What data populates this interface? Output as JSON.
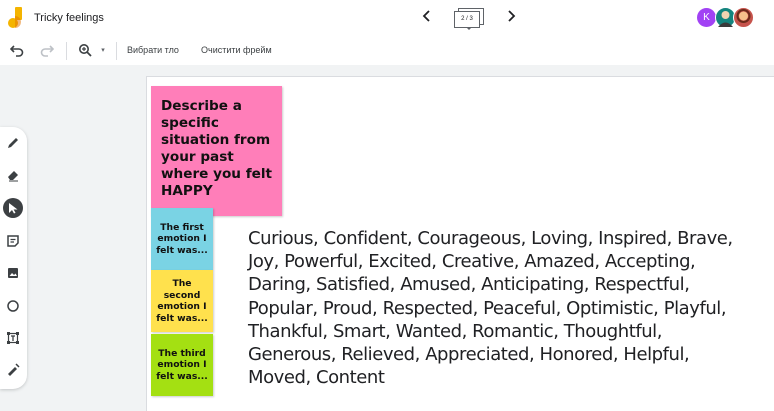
{
  "header": {
    "title": "Tricky feelings",
    "frame_indicator": "2 / 3"
  },
  "collaborators": [
    {
      "initial": "K",
      "color": "#a142f4"
    },
    {
      "initial": "",
      "color": "#14847e"
    },
    {
      "initial": "",
      "color": "#c6534c"
    }
  ],
  "toolbar": {
    "set_background_label": "Вибрати тло",
    "clear_frame_label": "Очистити фрейм"
  },
  "tools": [
    "pen-icon",
    "eraser-icon",
    "select-icon",
    "sticky-note-icon",
    "image-icon",
    "circle-icon",
    "text-box-icon",
    "laser-icon"
  ],
  "canvas": {
    "main_note": "Describe a specific situation from your past where you felt HAPPY",
    "notes": [
      {
        "text": "The first emotion I felt was...",
        "color": "#7ad3e4"
      },
      {
        "text": "The second emotion I felt was...",
        "color": "#ffe14d"
      },
      {
        "text": "The third emotion I felt was...",
        "color": "#a4e012"
      }
    ],
    "feelings_text": "Curious, Confident, Courageous, Loving, Inspired, Brave, Joy, Powerful, Excited, Creative, Amazed, Accepting, Daring, Satisfied, Amused, Anticipating, Respectful, Popular, Proud, Respected, Peaceful, Optimistic, Playful, Thankful, Smart, Wanted, Romantic, Thoughtful, Generous, Relieved, Appreciated, Honored, Helpful, Moved, Content"
  }
}
